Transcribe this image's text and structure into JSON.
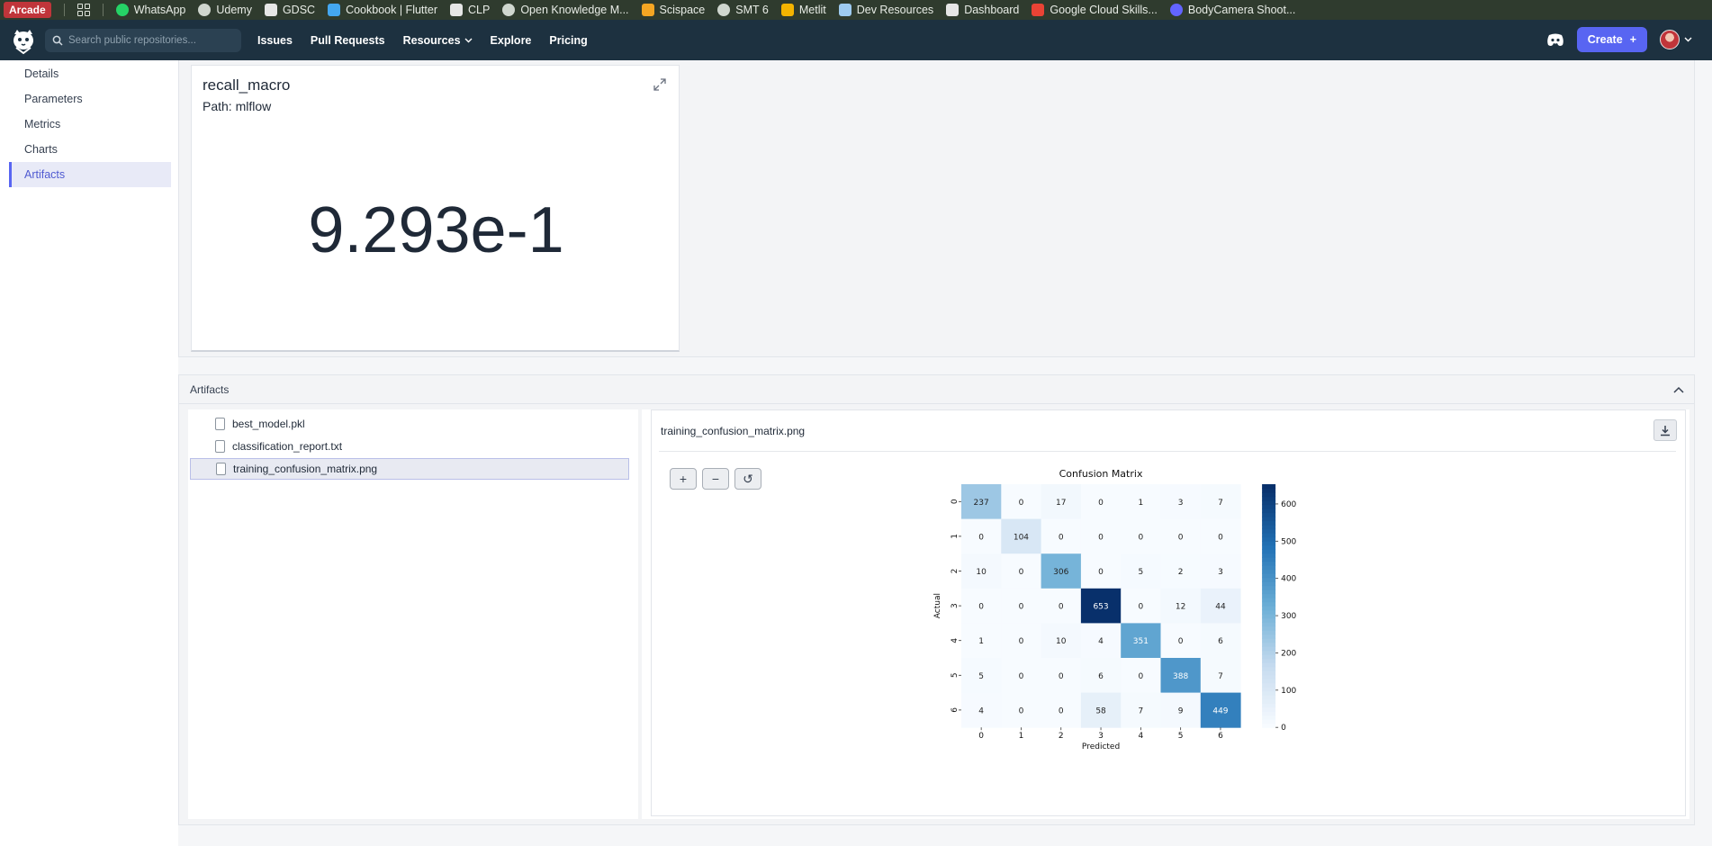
{
  "bookmarks": [
    {
      "label": "Arcade",
      "icon": "arcade-badge"
    },
    {
      "label": "",
      "icon": "apps-grid-icon"
    },
    {
      "label": "WhatsApp",
      "icon": "whatsapp-icon",
      "color": "#25d366"
    },
    {
      "label": "Udemy",
      "icon": "globe-icon",
      "color": "#cfd6cf"
    },
    {
      "label": "GDSC",
      "icon": "gdsc-icon",
      "color": "#e6e6e6"
    },
    {
      "label": "Cookbook | Flutter",
      "icon": "flutter-icon",
      "color": "#44a7f0"
    },
    {
      "label": "CLP",
      "icon": "clp-icon",
      "color": "#e6e6e6"
    },
    {
      "label": "Open Knowledge M...",
      "icon": "globe-icon",
      "color": "#cfd6cf"
    },
    {
      "label": "Scispace",
      "icon": "scispace-icon",
      "color": "#f5a623"
    },
    {
      "label": "SMT 6",
      "icon": "globe-icon",
      "color": "#cfd6cf"
    },
    {
      "label": "Metlit",
      "icon": "drive-icon",
      "color": "#f4b400"
    },
    {
      "label": "Dev Resources",
      "icon": "monitor-icon",
      "color": "#9ecbf0"
    },
    {
      "label": "Dashboard",
      "icon": "dashboard-icon",
      "color": "#e6e6e6"
    },
    {
      "label": "Google Cloud Skills...",
      "icon": "gcloud-icon",
      "color": "#ea4335"
    },
    {
      "label": "BodyCamera Shoot...",
      "icon": "mastodon-icon",
      "color": "#6364ff"
    }
  ],
  "nav": {
    "search_placeholder": "Search public repositories...",
    "links": [
      "Issues",
      "Pull Requests",
      "Resources",
      "Explore",
      "Pricing"
    ],
    "create_label": "Create"
  },
  "sidebar": {
    "items": [
      "Details",
      "Parameters",
      "Metrics",
      "Charts",
      "Artifacts"
    ],
    "active": "Artifacts"
  },
  "metric": {
    "title": "recall_macro",
    "path": "Path: mlflow",
    "value": "9.293e-1"
  },
  "artifacts": {
    "header": "Artifacts",
    "files": [
      "best_model.pkl",
      "classification_report.txt",
      "training_confusion_matrix.png"
    ],
    "selected": "training_confusion_matrix.png",
    "preview_title": "training_confusion_matrix.png",
    "zoom_in": "+",
    "zoom_out": "−",
    "reset": "↺"
  },
  "chart_data": {
    "type": "heatmap",
    "title": "Confusion Matrix",
    "xlabel": "Predicted",
    "ylabel": "Actual",
    "x": [
      "0",
      "1",
      "2",
      "3",
      "4",
      "5",
      "6"
    ],
    "y": [
      "0",
      "1",
      "2",
      "3",
      "4",
      "5",
      "6"
    ],
    "values": [
      [
        237,
        0,
        17,
        0,
        1,
        3,
        7
      ],
      [
        0,
        104,
        0,
        0,
        0,
        0,
        0
      ],
      [
        10,
        0,
        306,
        0,
        5,
        2,
        3
      ],
      [
        0,
        0,
        0,
        653,
        0,
        12,
        44
      ],
      [
        1,
        0,
        10,
        4,
        351,
        0,
        6
      ],
      [
        5,
        0,
        0,
        6,
        0,
        388,
        7
      ],
      [
        4,
        0,
        0,
        58,
        7,
        9,
        449
      ]
    ],
    "colorbar": {
      "range": [
        0,
        653
      ],
      "ticks": [
        0,
        100,
        200,
        300,
        400,
        500,
        600
      ]
    },
    "colormap": "Blues"
  }
}
